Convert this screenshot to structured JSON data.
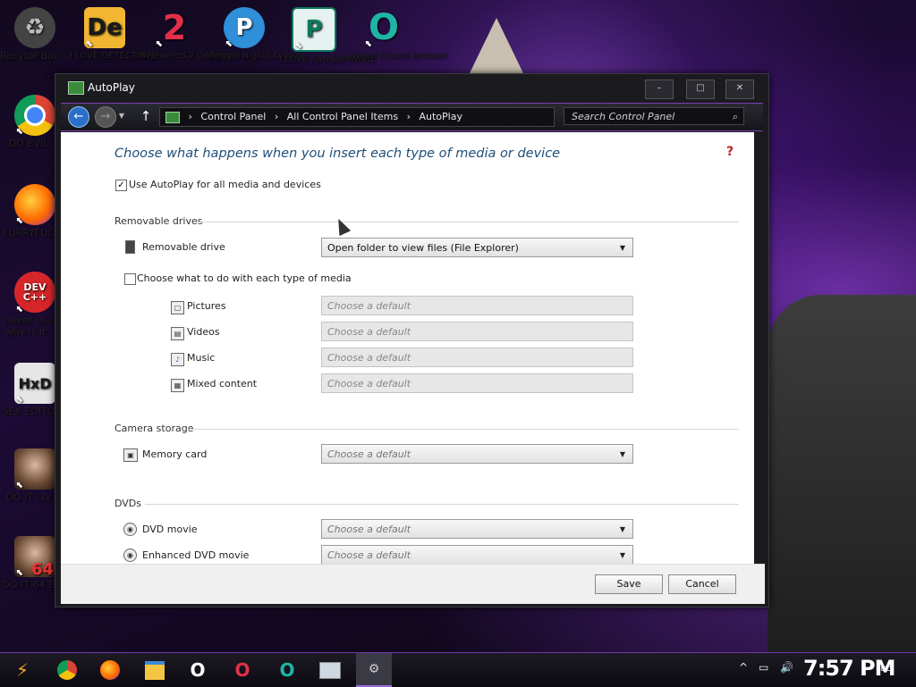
{
  "desktop": {
    "icons": [
      {
        "label": "Recycle Bin",
        "icon": "recycle-bin-icon"
      },
      {
        "label": "I LOVE DETECTING",
        "icon": "de-app-icon",
        "glyph": "De"
      },
      {
        "label": "Bejeweled 2 Deluxe",
        "icon": "bejeweled-icon",
        "glyph": "2"
      },
      {
        "label": "Peggle Nights Deluxe",
        "icon": "peggle-icon",
        "glyph": "P"
      },
      {
        "label": "I LOVE RANSOMWARE",
        "icon": "publisher-icon",
        "glyph": "P"
      },
      {
        "label": "Opera Crypto Browser",
        "icon": "opera-crypto-icon",
        "glyph": "O"
      },
      {
        "label": "DO EVIL",
        "icon": "chrome-icon"
      },
      {
        "label": "FURRYFUC",
        "icon": "firefox-icon"
      },
      {
        "label": "never use why is it .",
        "icon": "dev-cpp-icon",
        "glyph": "DEV C++"
      },
      {
        "label": "SEX EDITO",
        "icon": "hxd-icon",
        "glyph": "HxD"
      },
      {
        "label": "DO IT LIV",
        "icon": "portrait-icon"
      },
      {
        "label": "DO IT 64 B",
        "icon": "portrait-64-icon",
        "glyph": "64"
      }
    ]
  },
  "window": {
    "title": "AutoPlay",
    "minimize": "–",
    "maximize": "□",
    "close": "✕",
    "breadcrumb": [
      "Control Panel",
      "All Control Panel Items",
      "AutoPlay"
    ],
    "search_placeholder": "Search Control Panel",
    "heading": "Choose what happens when you insert each type of media or device",
    "help": "?",
    "use_autoplay_label": "Use AutoPlay for all media and devices",
    "use_autoplay_checked": true,
    "sections": {
      "removable": {
        "title": "Removable drives",
        "drive_label": "Removable drive",
        "drive_value": "Open folder to view files (File Explorer)",
        "each_type_label": "Choose what to do with each type of media",
        "each_type_checked": false,
        "media": [
          {
            "label": "Pictures",
            "value": "Choose a default"
          },
          {
            "label": "Videos",
            "value": "Choose a default"
          },
          {
            "label": "Music",
            "value": "Choose a default"
          },
          {
            "label": "Mixed content",
            "value": "Choose a default"
          }
        ]
      },
      "camera": {
        "title": "Camera storage",
        "memory_label": "Memory card",
        "memory_value": "Choose a default"
      },
      "dvds": {
        "title": "DVDs",
        "items": [
          {
            "label": "DVD movie",
            "value": "Choose a default"
          },
          {
            "label": "Enhanced DVD movie",
            "value": "Choose a default"
          }
        ]
      }
    },
    "save_label": "Save",
    "cancel_label": "Cancel"
  },
  "taskbar": {
    "clock": "7:57 PM"
  },
  "colors": {
    "heading": "#1e4e79",
    "accent": "#7a3fb0"
  }
}
